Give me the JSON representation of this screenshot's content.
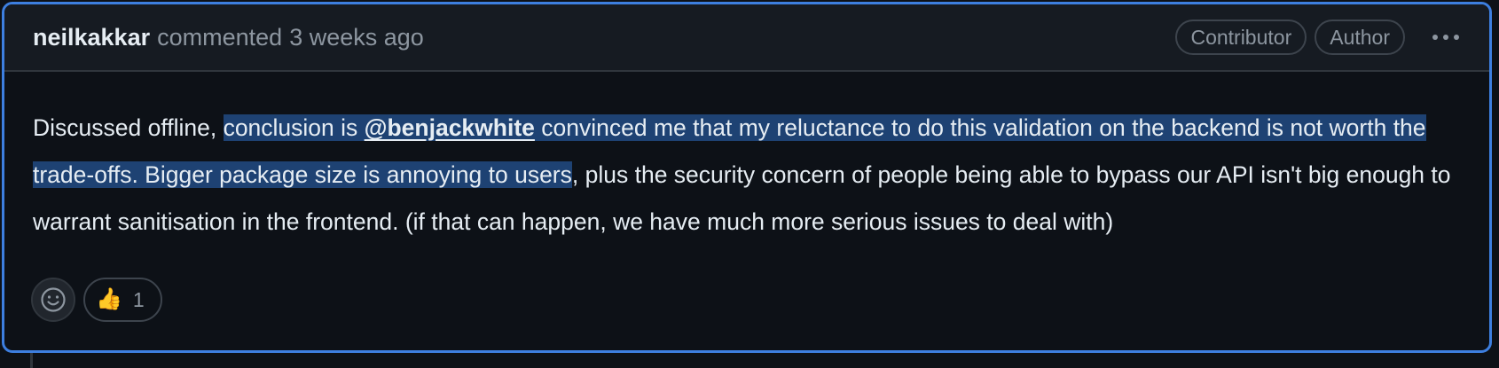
{
  "comment": {
    "author": "neilkakkar",
    "action": "commented",
    "time": "3 weeks ago",
    "badges": [
      "Contributor",
      "Author"
    ],
    "body": {
      "t1": "Discussed offline, ",
      "t2": "conclusion is ",
      "mention": "@benjackwhite",
      "t3": " convinced me that my reluctance to do this validation on the backend is not worth the trade-offs. Bigger package size is annoying to users",
      "t4": ", plus the security concern of people being able to bypass our API isn't big enough to warrant sanitisation in the frontend. (if that can happen, we have much more serious issues to deal with)"
    }
  },
  "reactions": [
    {
      "emoji": "👍",
      "count": "1"
    }
  ],
  "icons": {
    "add_reaction": "smiley-icon",
    "menu": "kebab-horizontal-icon"
  },
  "colors": {
    "background": "#0d1117",
    "header": "#161b22",
    "focus_border": "#3d7fe0",
    "selection": "#1e4273",
    "text": "#e6edf3",
    "muted": "#8d96a0"
  }
}
